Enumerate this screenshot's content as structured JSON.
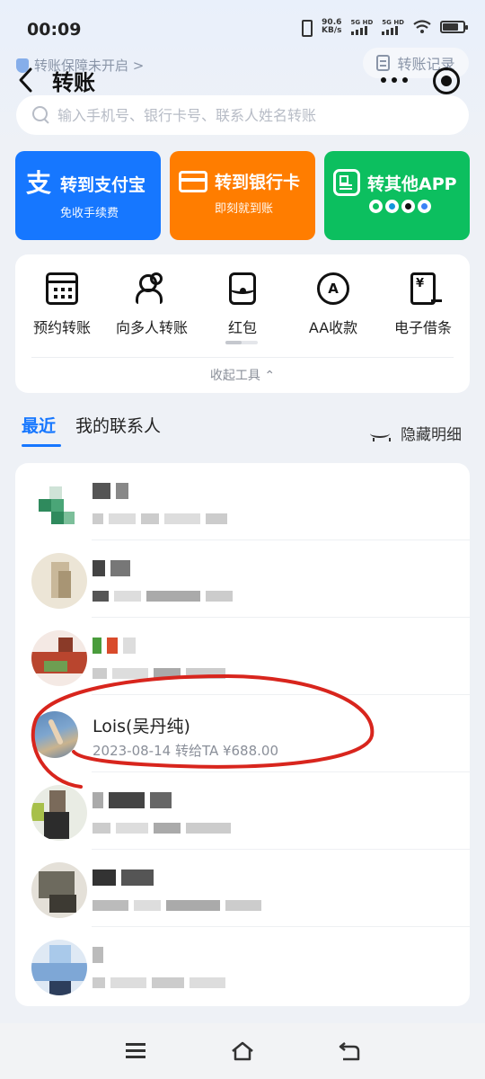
{
  "status_bar": {
    "time": "00:09",
    "net_speed_value": "90.6",
    "net_speed_unit": "KB/s",
    "sim1_label": "5G HD",
    "sim2_label": "5G HD",
    "battery_level": 0.75
  },
  "header": {
    "banner_text": "转账保障未开启 >",
    "record_label": "转账记录",
    "title": "转账"
  },
  "search": {
    "placeholder": "输入手机号、银行卡号、联系人姓名转账"
  },
  "transfer_cards": [
    {
      "title": "转到支付宝",
      "subtitle": "免收手续费",
      "color": "#1677ff",
      "icon": "alipay-icon"
    },
    {
      "title": "转到银行卡",
      "subtitle": "即刻就到账",
      "color": "#ff7d00",
      "icon": "bank-card-icon"
    },
    {
      "title": "转其他APP",
      "subtitle": "",
      "color": "#0cbf5f",
      "icon": "app-grid-icon",
      "sub_icons": [
        "wechat-icon",
        "qq-icon",
        "douyin-icon",
        "other-app-icon"
      ]
    }
  ],
  "tools": {
    "items": [
      {
        "label": "预约转账",
        "icon": "calendar-icon"
      },
      {
        "label": "向多人转账",
        "icon": "people-icon"
      },
      {
        "label": "红包",
        "icon": "red-packet-icon"
      },
      {
        "label": "AA收款",
        "icon": "aa-icon"
      },
      {
        "label": "电子借条",
        "icon": "loan-note-icon"
      }
    ],
    "collapse_label": "收起工具 ⌃"
  },
  "tabs": {
    "recent": "最近",
    "contacts": "我的联系人",
    "hide_details": "隐藏明细"
  },
  "contacts": {
    "visible_contact": {
      "name": "Lois(吴丹纯)",
      "detail": "2023-08-14 转给TA ¥688.00"
    }
  },
  "colors": {
    "accent": "#1677ff",
    "annotation": "#d8251d"
  }
}
